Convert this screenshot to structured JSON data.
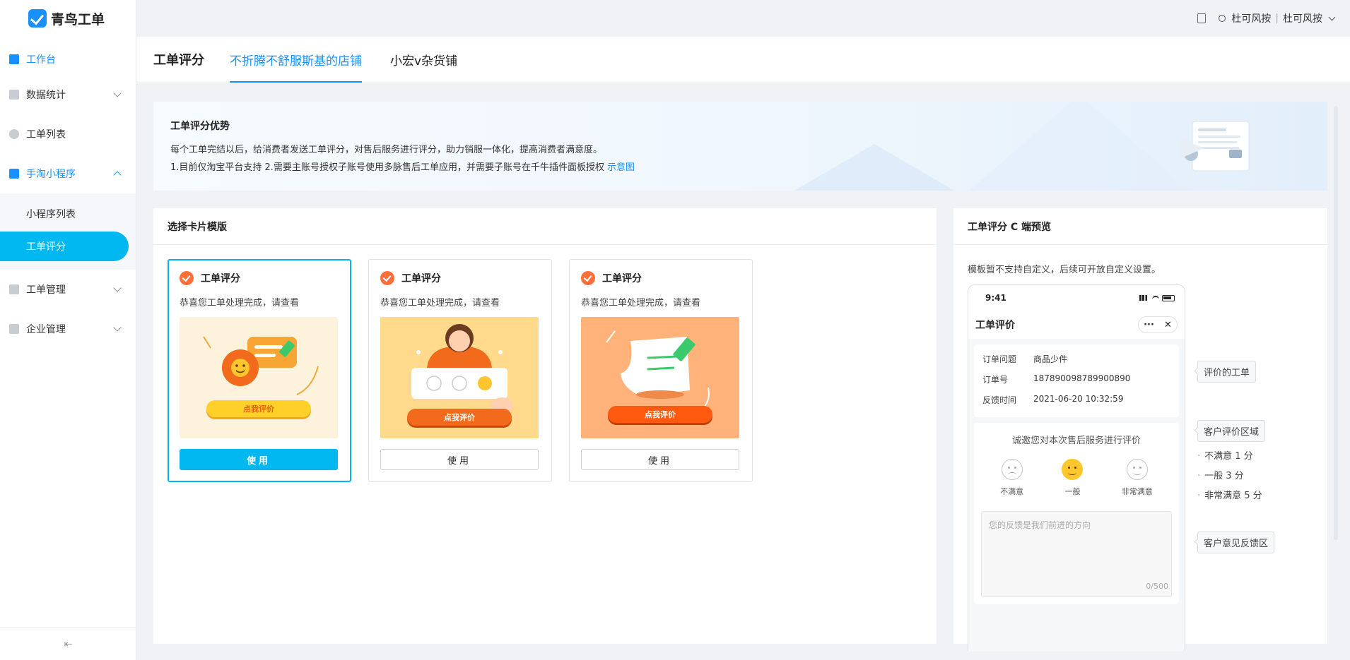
{
  "app": {
    "name": "青鸟工单"
  },
  "topbar": {
    "user1": "杜可风按",
    "user2": "杜可风按"
  },
  "sidebar": {
    "items": [
      {
        "label": "工作台"
      },
      {
        "label": "数据统计"
      },
      {
        "label": "工单列表"
      },
      {
        "label": "手淘小程序"
      },
      {
        "label": "工单管理"
      },
      {
        "label": "企业管理"
      }
    ],
    "sub_items": [
      {
        "label": "小程序列表"
      },
      {
        "label": "工单评分"
      }
    ],
    "collapse_glyph": "⇤"
  },
  "tabs": [
    {
      "label": "工单评分"
    },
    {
      "label": "不折腾不舒服斯基的店铺"
    },
    {
      "label": "小宏v杂货铺"
    }
  ],
  "banner": {
    "title": "工单评分优势",
    "line1": "每个工单完结以后，给消费者发送工单评分，对售后服务进行评分，助力销服一体化，提高消费者满意度。",
    "line2": "1.目前仅淘宝平台支持 2.需要主账号授权子账号使用多脉售后工单应用，并需要子账号在千牛插件面板授权",
    "link": "示意图"
  },
  "templates": {
    "heading": "选择卡片模版",
    "cards": [
      {
        "title": "工单评分",
        "subtitle": "恭喜您工单处理完成，请查看",
        "cta": "点我评价",
        "button": "使用"
      },
      {
        "title": "工单评分",
        "subtitle": "恭喜您工单处理完成，请查看",
        "cta": "点我评价",
        "button": "使用"
      },
      {
        "title": "工单评分",
        "subtitle": "恭喜您工单处理完成，请查看",
        "cta": "点我评价",
        "button": "使用"
      }
    ]
  },
  "preview": {
    "heading": "工单评分 C 端预览",
    "note": "模板暂不支持自定义，后续可开放自定义设置。",
    "phone": {
      "time": "9:41",
      "nav_title": "工单评价",
      "more": "···",
      "close": "✕",
      "order": [
        {
          "key": "订单问题",
          "value": "商品少件"
        },
        {
          "key": "订单号",
          "value": "187890098789900890"
        },
        {
          "key": "反馈时间",
          "value": "2021-06-20  10:32:59"
        }
      ],
      "rate_title": "诚邀您对本次售后服务进行评价",
      "faces": [
        {
          "label": "不满意"
        },
        {
          "label": "一般"
        },
        {
          "label": "非常满意"
        }
      ],
      "feedback_placeholder": "您的反馈是我们前进的方向",
      "counter": "0/500"
    },
    "annotations": {
      "order_area": "评价的工单",
      "rating_area": "客户评价区域",
      "scores": [
        "不满意 1 分",
        "一般 3 分",
        "非常满意 5 分"
      ],
      "feedback_area": "客户意见反馈区"
    }
  }
}
